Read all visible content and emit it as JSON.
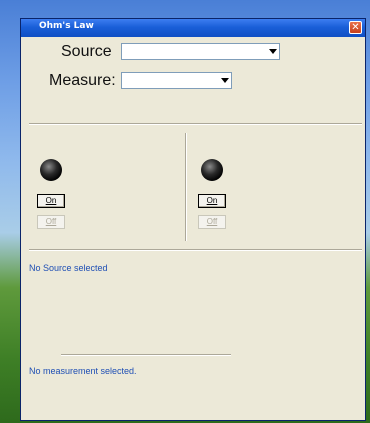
{
  "window": {
    "title": "Ohm's Law"
  },
  "source": {
    "label": "Source",
    "value": ""
  },
  "measure": {
    "label": "Measure:",
    "value": ""
  },
  "left_panel": {
    "on_label": "On",
    "off_label": "Off"
  },
  "right_panel": {
    "on_label": "On",
    "off_label": "Off"
  },
  "status": {
    "source": "No Source selected",
    "measurement": "No measurement selected."
  },
  "icons": [
    "close-icon",
    "dropdown-arrow-icon",
    "led-indicator"
  ]
}
